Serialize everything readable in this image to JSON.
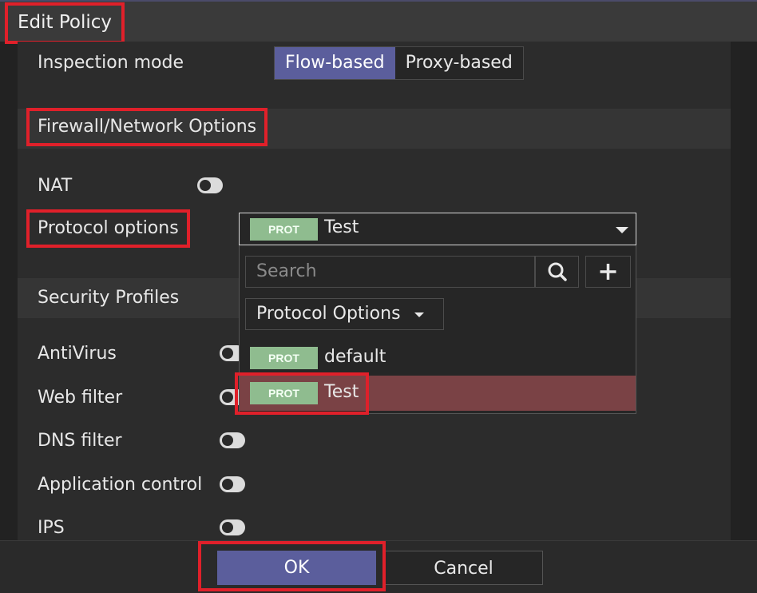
{
  "dialog": {
    "title": "Edit Policy"
  },
  "inspection": {
    "label": "Inspection mode",
    "options": [
      "Flow-based",
      "Proxy-based"
    ],
    "selected": "Flow-based"
  },
  "firewall_section": {
    "title": "Firewall/Network Options"
  },
  "nat": {
    "label": "NAT",
    "enabled": false
  },
  "protocol": {
    "label": "Protocol options",
    "badge": "PROT",
    "selected": "Test",
    "search_placeholder": "Search",
    "filter_label": "Protocol Options",
    "items": [
      {
        "badge": "PROT",
        "name": "default",
        "selected": false
      },
      {
        "badge": "PROT",
        "name": "Test",
        "selected": true
      }
    ]
  },
  "security_section": {
    "title": "Security Profiles"
  },
  "profiles": [
    {
      "label": "AntiVirus",
      "enabled": false
    },
    {
      "label": "Web filter",
      "enabled": false
    },
    {
      "label": "DNS filter",
      "enabled": false
    },
    {
      "label": "Application control",
      "enabled": false
    },
    {
      "label": "IPS",
      "enabled": false
    }
  ],
  "footer": {
    "ok_label": "OK",
    "cancel_label": "Cancel"
  },
  "colors": {
    "accent": "#5b5e9c",
    "highlight": "#e0202a",
    "badge": "#8fbc8f",
    "selected_row": "#7a4245"
  },
  "icons": {
    "search": "search-icon",
    "add": "plus-icon",
    "caret": "caret-down-icon"
  }
}
